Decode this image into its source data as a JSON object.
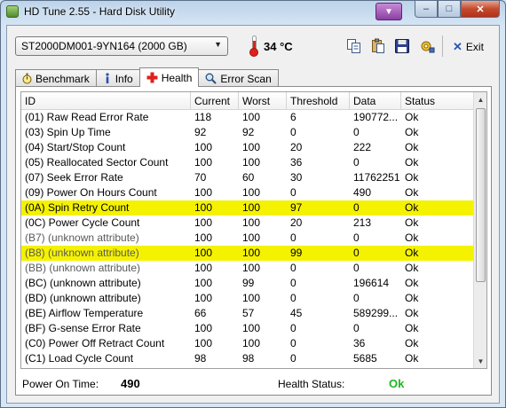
{
  "window": {
    "title": "HD Tune 2.55 - Hard Disk Utility",
    "caption_min": "–",
    "caption_max": "□",
    "caption_close": "✕"
  },
  "toolbar": {
    "drive": "ST2000DM001-9YN164 (2000 GB)",
    "temperature": "34 °C",
    "exit_label": "Exit"
  },
  "tabs": [
    {
      "label": "Benchmark",
      "icon": "stopwatch-icon"
    },
    {
      "label": "Info",
      "icon": "info-icon"
    },
    {
      "label": "Health",
      "icon": "health-cross-icon",
      "active": true
    },
    {
      "label": "Error Scan",
      "icon": "magnifier-icon"
    }
  ],
  "table": {
    "columns": [
      "ID",
      "Current",
      "Worst",
      "Threshold",
      "Data",
      "Status"
    ],
    "rows": [
      {
        "id": "(01) Raw Read Error Rate",
        "current": "118",
        "worst": "100",
        "threshold": "6",
        "data": "190772...",
        "status": "Ok"
      },
      {
        "id": "(03) Spin Up Time",
        "current": "92",
        "worst": "92",
        "threshold": "0",
        "data": "0",
        "status": "Ok"
      },
      {
        "id": "(04) Start/Stop Count",
        "current": "100",
        "worst": "100",
        "threshold": "20",
        "data": "222",
        "status": "Ok"
      },
      {
        "id": "(05) Reallocated Sector Count",
        "current": "100",
        "worst": "100",
        "threshold": "36",
        "data": "0",
        "status": "Ok"
      },
      {
        "id": "(07) Seek Error Rate",
        "current": "70",
        "worst": "60",
        "threshold": "30",
        "data": "11762251",
        "status": "Ok"
      },
      {
        "id": "(09) Power On Hours Count",
        "current": "100",
        "worst": "100",
        "threshold": "0",
        "data": "490",
        "status": "Ok"
      },
      {
        "id": "(0A) Spin Retry Count",
        "current": "100",
        "worst": "100",
        "threshold": "97",
        "data": "0",
        "status": "Ok",
        "highlight": true
      },
      {
        "id": "(0C) Power Cycle Count",
        "current": "100",
        "worst": "100",
        "threshold": "20",
        "data": "213",
        "status": "Ok"
      },
      {
        "id": "(B7) (unknown attribute)",
        "current": "100",
        "worst": "100",
        "threshold": "0",
        "data": "0",
        "status": "Ok",
        "unknown": true
      },
      {
        "id": "(B8) (unknown attribute)",
        "current": "100",
        "worst": "100",
        "threshold": "99",
        "data": "0",
        "status": "Ok",
        "highlight": true,
        "unknown": true
      },
      {
        "id": "(BB) (unknown attribute)",
        "current": "100",
        "worst": "100",
        "threshold": "0",
        "data": "0",
        "status": "Ok",
        "unknown": true
      },
      {
        "id": "(BC) (unknown attribute)",
        "current": "100",
        "worst": "99",
        "threshold": "0",
        "data": "196614",
        "status": "Ok"
      },
      {
        "id": "(BD) (unknown attribute)",
        "current": "100",
        "worst": "100",
        "threshold": "0",
        "data": "0",
        "status": "Ok"
      },
      {
        "id": "(BE) Airflow Temperature",
        "current": "66",
        "worst": "57",
        "threshold": "45",
        "data": "589299...",
        "status": "Ok"
      },
      {
        "id": "(BF) G-sense Error Rate",
        "current": "100",
        "worst": "100",
        "threshold": "0",
        "data": "0",
        "status": "Ok"
      },
      {
        "id": "(C0) Power Off Retract Count",
        "current": "100",
        "worst": "100",
        "threshold": "0",
        "data": "36",
        "status": "Ok"
      },
      {
        "id": "(C1) Load Cycle Count",
        "current": "98",
        "worst": "98",
        "threshold": "0",
        "data": "5685",
        "status": "Ok"
      }
    ]
  },
  "footer": {
    "power_on_label": "Power On Time:",
    "power_on_value": "490",
    "health_label": "Health Status:",
    "health_value": "Ok"
  },
  "colors": {
    "highlight": "#f5f200",
    "health_ok": "#1fb61f",
    "temperature_red": "#e0201c"
  }
}
